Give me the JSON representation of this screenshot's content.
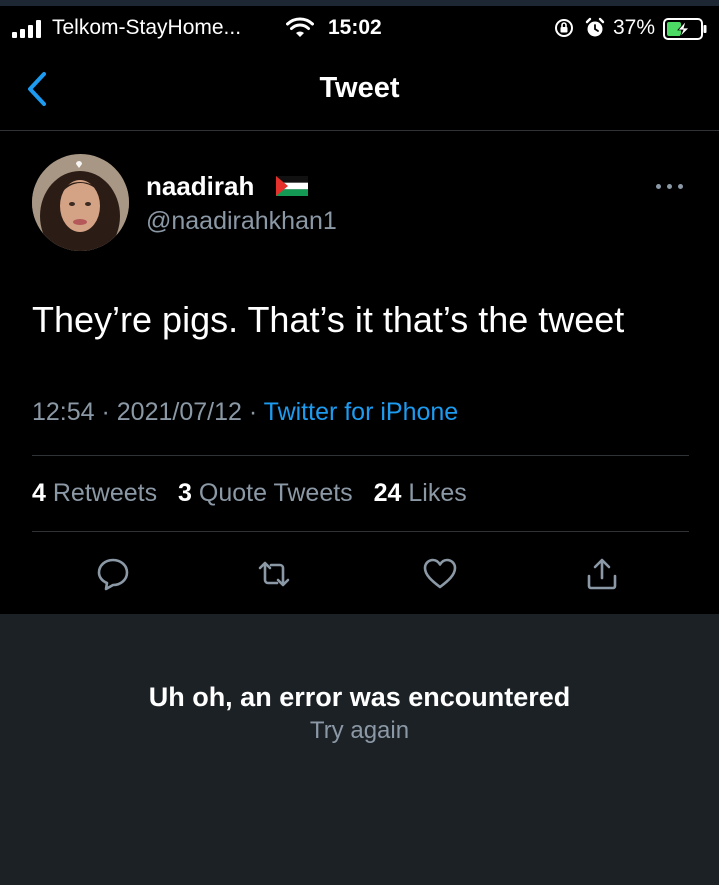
{
  "status_bar": {
    "carrier": "Telkom-StayHome...",
    "time": "15:02",
    "battery_percent": "37%",
    "icons": [
      "signal-icon",
      "wifi-icon",
      "orientation-lock-icon",
      "alarm-icon",
      "battery-charging-icon"
    ]
  },
  "nav": {
    "title": "Tweet",
    "back_icon": "chevron-left-icon"
  },
  "tweet": {
    "display_name": "naadirah",
    "handle": "@naadirahkhan1",
    "text": "They’re pigs. That’s it that’s the tweet",
    "time": "12:54",
    "separator": " · ",
    "date": "2021/07/12",
    "source": "Twitter for iPhone",
    "stats": {
      "retweets_count": "4",
      "retweets_label": "Retweets",
      "quotes_count": "3",
      "quotes_label": "Quote Tweets",
      "likes_count": "24",
      "likes_label": "Likes"
    },
    "actions": [
      "reply-icon",
      "retweet-icon",
      "like-icon",
      "share-icon"
    ]
  },
  "error": {
    "title": "Uh oh, an error was encountered",
    "retry_label": "Try again"
  },
  "colors": {
    "background": "#000000",
    "accent": "#1d9bf0",
    "secondary_text": "#8b98a5",
    "error_panel": "#1c2126"
  }
}
